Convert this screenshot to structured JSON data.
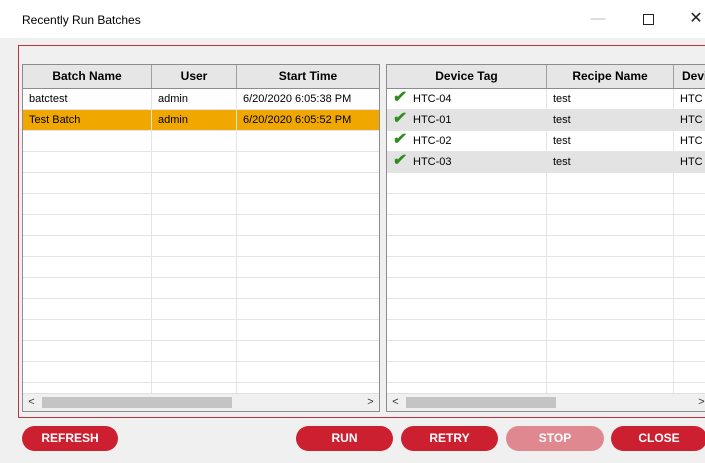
{
  "window": {
    "title": "Recently Run Batches",
    "minimize_glyph": "—",
    "close_glyph": "✕"
  },
  "batches": {
    "columns": [
      "Batch Name",
      "User",
      "Start Time"
    ],
    "rows": [
      [
        "batctest",
        "admin",
        "6/20/2020 6:05:38 PM"
      ],
      [
        "Test Batch",
        "admin",
        "6/20/2020 6:05:52 PM"
      ]
    ],
    "selected_row": 1
  },
  "devices": {
    "columns": [
      "Device Tag",
      "Recipe Name",
      "Devi"
    ],
    "rows": [
      [
        "HTC-04",
        "test",
        "HTC"
      ],
      [
        "HTC-01",
        "test",
        "HTC"
      ],
      [
        "HTC-02",
        "test",
        "HTC"
      ],
      [
        "HTC-03",
        "test",
        "HTC"
      ]
    ],
    "status_icon": "checkmark-icon",
    "status_glyph": "✔"
  },
  "scrollbars": {
    "left_arrow": "<",
    "right_arrow": ">"
  },
  "buttons": {
    "refresh": "REFRESH",
    "run": "RUN",
    "retry": "RETRY",
    "stop": "STOP",
    "close": "CLOSE"
  },
  "colors": {
    "accent_red": "#cc2030",
    "selected_row": "#f0a800",
    "check_green": "#2e8b1e"
  }
}
